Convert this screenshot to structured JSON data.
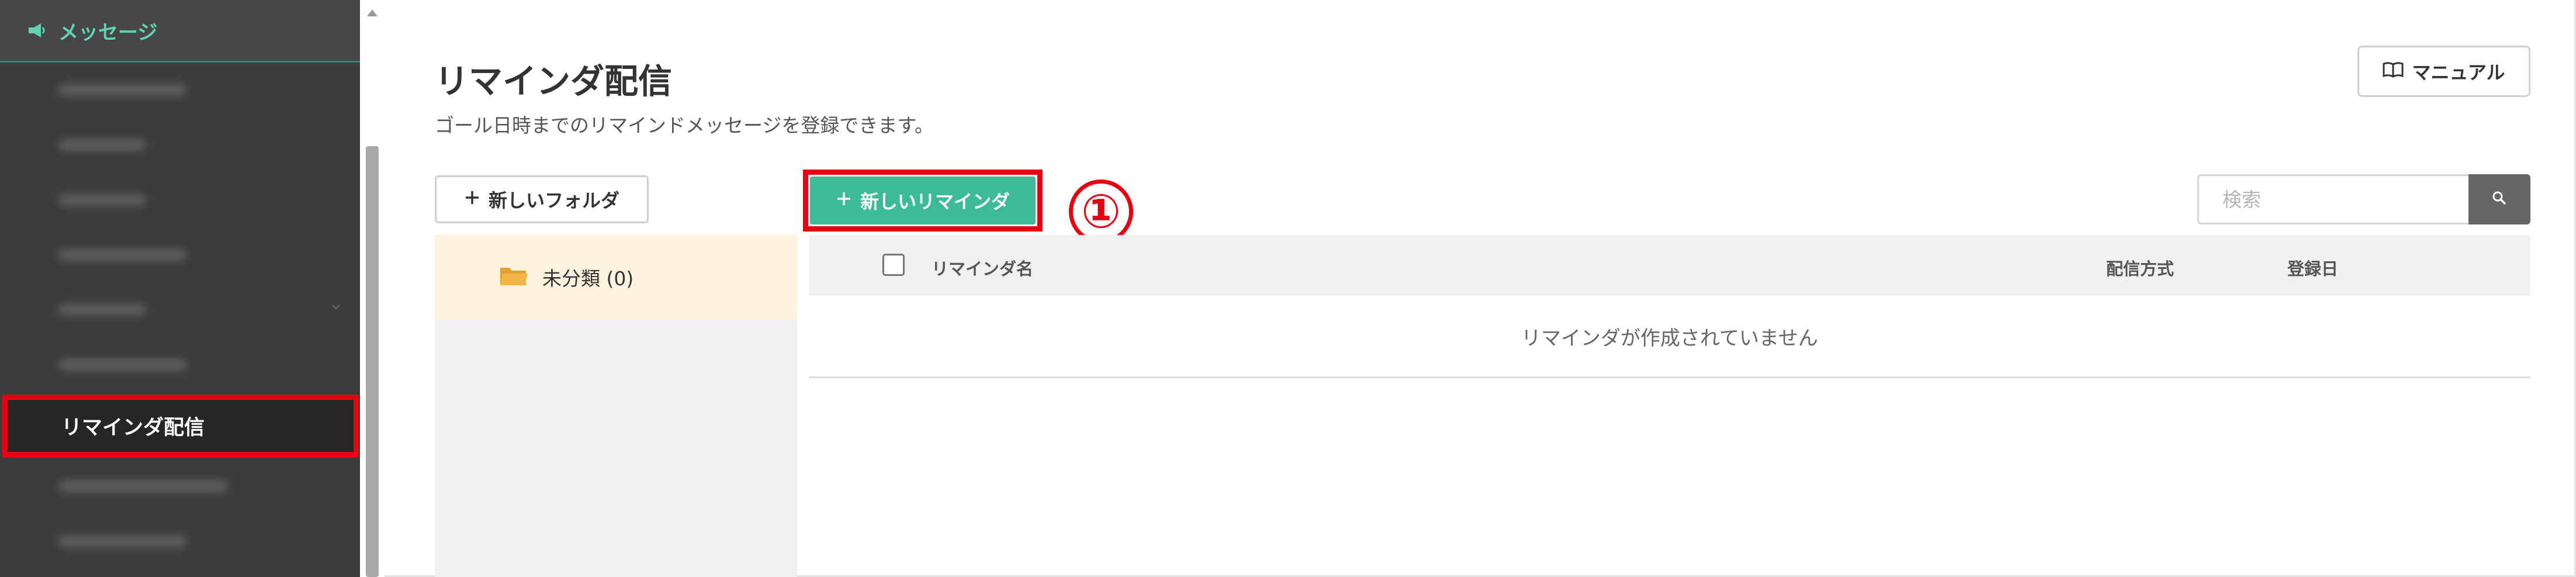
{
  "sidebar": {
    "section_title": "メッセージ",
    "section_icon": "megaphone-icon",
    "active_item": "リマインダ配信"
  },
  "page": {
    "title": "リマインダ配信",
    "description": "ゴール日時までのリマインドメッセージを登録できます。"
  },
  "toolbar": {
    "manual_label": "マニュアル",
    "new_folder_label": "新しいフォルダ",
    "new_reminder_label": "新しいリマインダ",
    "step_marker": "①",
    "search_placeholder": "検索"
  },
  "folders": [
    {
      "label": "未分類 (0)"
    }
  ],
  "table": {
    "columns": [
      "リマインダ名",
      "配信方式",
      "登録日"
    ],
    "empty_message": "リマインダが作成されていません"
  },
  "colors": {
    "sidebar_bg": "#3c3c3c",
    "accent_green": "#3dbb96",
    "highlight_red": "#e50012",
    "folder_selected_bg": "#fdf3df"
  }
}
